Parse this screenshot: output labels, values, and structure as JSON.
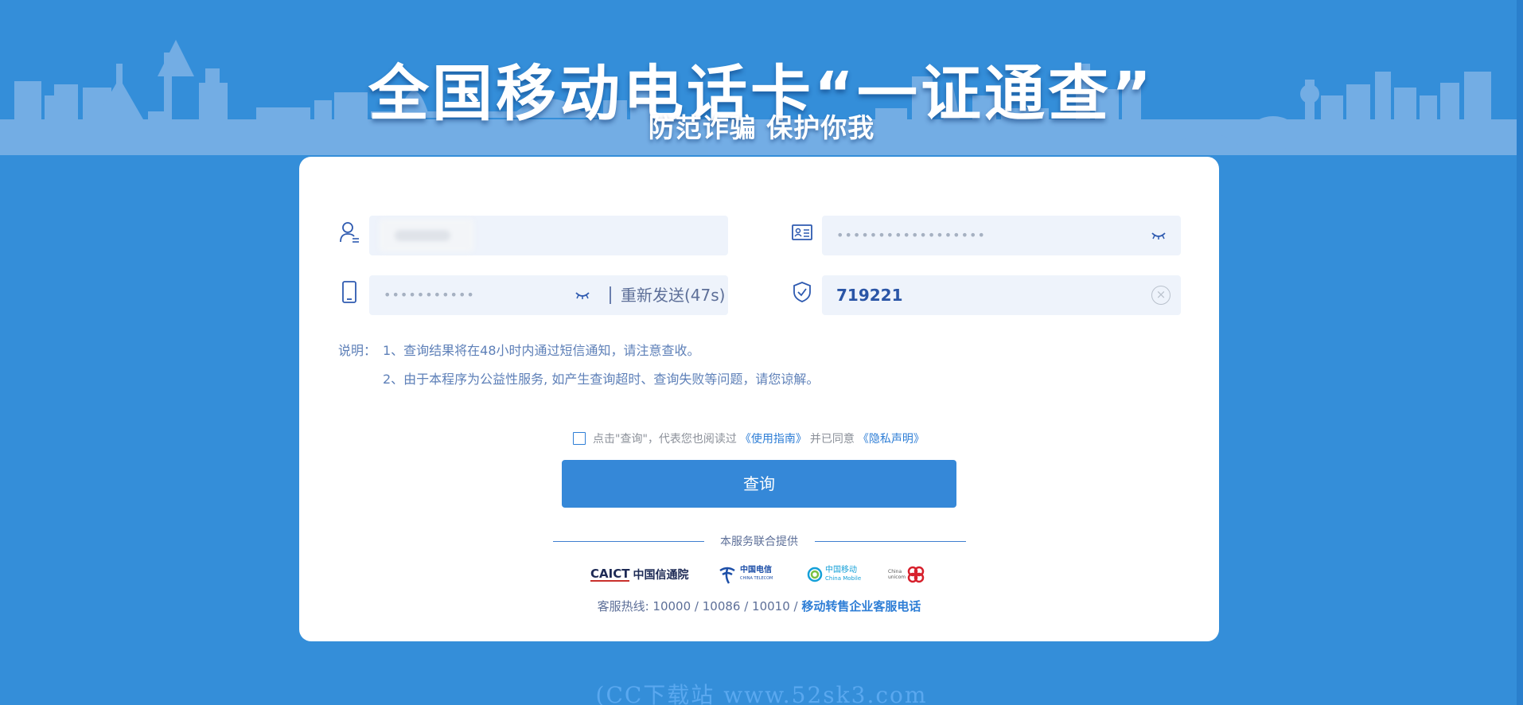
{
  "banner": {
    "title": "全国移动电话卡“一证通查”",
    "subtitle": "防范诈骗 保护你我"
  },
  "form": {
    "name_value": "",
    "id_value": "••••••••••••••••••",
    "phone_value": "•••••••••••",
    "resend_label": "重新发送(47s)",
    "sms_code_value": "719221"
  },
  "notes": {
    "label": "说明：",
    "lines": [
      "1、查询结果将在48小时内通过短信通知，请注意查收。",
      "2、由于本程序为公益性服务, 如产生查询超时、查询失败等问题，请您谅解。"
    ]
  },
  "agreement": {
    "prefix": "点击\"查询\"，代表您也阅读过",
    "guide_link": "《使用指南》",
    "middle": "并已同意",
    "privacy_link": "《隐私声明》"
  },
  "query_button": "查询",
  "footer": {
    "provider_text": "本服务联合提供",
    "logos": {
      "caict": "CAICT",
      "caict_cn": "中国信通院",
      "telecom_cn": "中国电信",
      "telecom_en": "CHINA TELECOM",
      "mobile_cn": "中国移动",
      "mobile_en": "China Mobile",
      "unicom_en": "China unicom"
    },
    "hotline_prefix": "客服热线: 10000 / 10086 / 10010 / ",
    "hotline_link": "移动转售企业客服电话"
  },
  "watermark": "(CC下载站 www.52sk3.com",
  "colors": {
    "background": "#348ed9",
    "accent": "#3588d8",
    "link": "#2e7ed6"
  }
}
